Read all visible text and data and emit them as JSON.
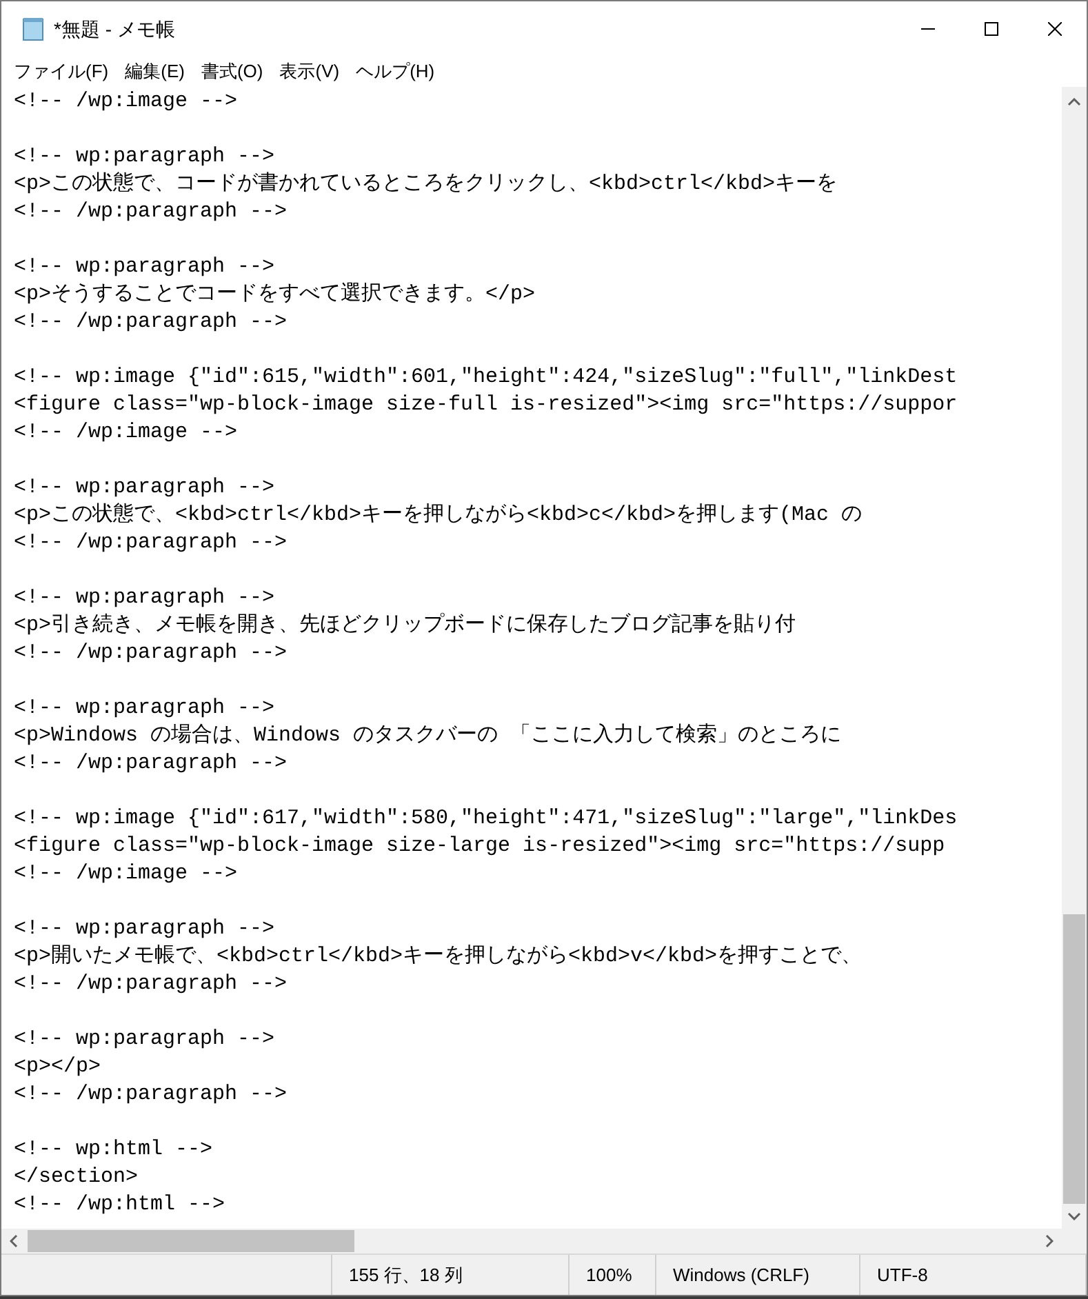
{
  "window": {
    "title": "*無題 - メモ帳"
  },
  "menu": [
    "ファイル(F)",
    "編集(E)",
    "書式(O)",
    "表示(V)",
    "ヘルプ(H)"
  ],
  "editor": {
    "blocks": [
      [
        "<!-- /wp:image -->"
      ],
      [
        "<!-- wp:paragraph -->",
        "<p>この状態で、コードが書かれているところをクリックし、<kbd>ctrl</kbd>キーを",
        "<!-- /wp:paragraph -->"
      ],
      [
        "<!-- wp:paragraph -->",
        "<p>そうすることでコードをすべて選択できます。</p>",
        "<!-- /wp:paragraph -->"
      ],
      [
        "<!-- wp:image {\"id\":615,\"width\":601,\"height\":424,\"sizeSlug\":\"full\",\"linkDest",
        "<figure class=\"wp-block-image size-full is-resized\"><img src=\"https://suppor",
        "<!-- /wp:image -->"
      ],
      [
        "<!-- wp:paragraph -->",
        "<p>この状態で、<kbd>ctrl</kbd>キーを押しながら<kbd>c</kbd>を押します(Mac の",
        "<!-- /wp:paragraph -->"
      ],
      [
        "<!-- wp:paragraph -->",
        "<p>引き続き、メモ帳を開き、先ほどクリップボードに保存したブログ記事を貼り付",
        "<!-- /wp:paragraph -->"
      ],
      [
        "<!-- wp:paragraph -->",
        "<p>Windows の場合は、Windows のタスクバーの 「ここに入力して検索」のところに",
        "<!-- /wp:paragraph -->"
      ],
      [
        "<!-- wp:image {\"id\":617,\"width\":580,\"height\":471,\"sizeSlug\":\"large\",\"linkDes",
        "<figure class=\"wp-block-image size-large is-resized\"><img src=\"https://supp",
        "<!-- /wp:image -->"
      ],
      [
        "<!-- wp:paragraph -->",
        "<p>開いたメモ帳で、<kbd>ctrl</kbd>キーを押しながら<kbd>v</kbd>を押すことで、",
        "<!-- /wp:paragraph -->"
      ],
      [
        "<!-- wp:paragraph -->",
        "<p></p>",
        "<!-- /wp:paragraph -->"
      ],
      [
        "<!-- wp:html -->",
        "</section>",
        "<!-- /wp:html -->"
      ]
    ]
  },
  "status_bar": [
    "155 行、18 列",
    "100%",
    "Windows (CRLF)",
    "UTF-8"
  ]
}
